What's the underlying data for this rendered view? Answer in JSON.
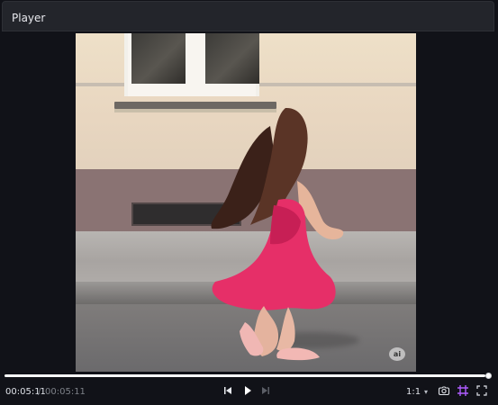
{
  "window": {
    "title": "Player"
  },
  "video": {
    "watermark_text": "ai"
  },
  "playback": {
    "current_time": "00:05:11",
    "time_separator": "/",
    "total_time": "00:05:11",
    "progress_fraction": 1.0
  },
  "toolbar": {
    "ratio_label": "1:1",
    "ratio_menu_icon": "chevron-down-icon",
    "screenshot_icon": "camera-icon",
    "grid_icon": "grid-icon",
    "fullscreen_icon": "fullscreen-icon"
  },
  "colors": {
    "accent": "#b05cff",
    "panel_bg": "#111218",
    "titlebar_bg": "#23252b",
    "timeline": "#ffffff"
  }
}
